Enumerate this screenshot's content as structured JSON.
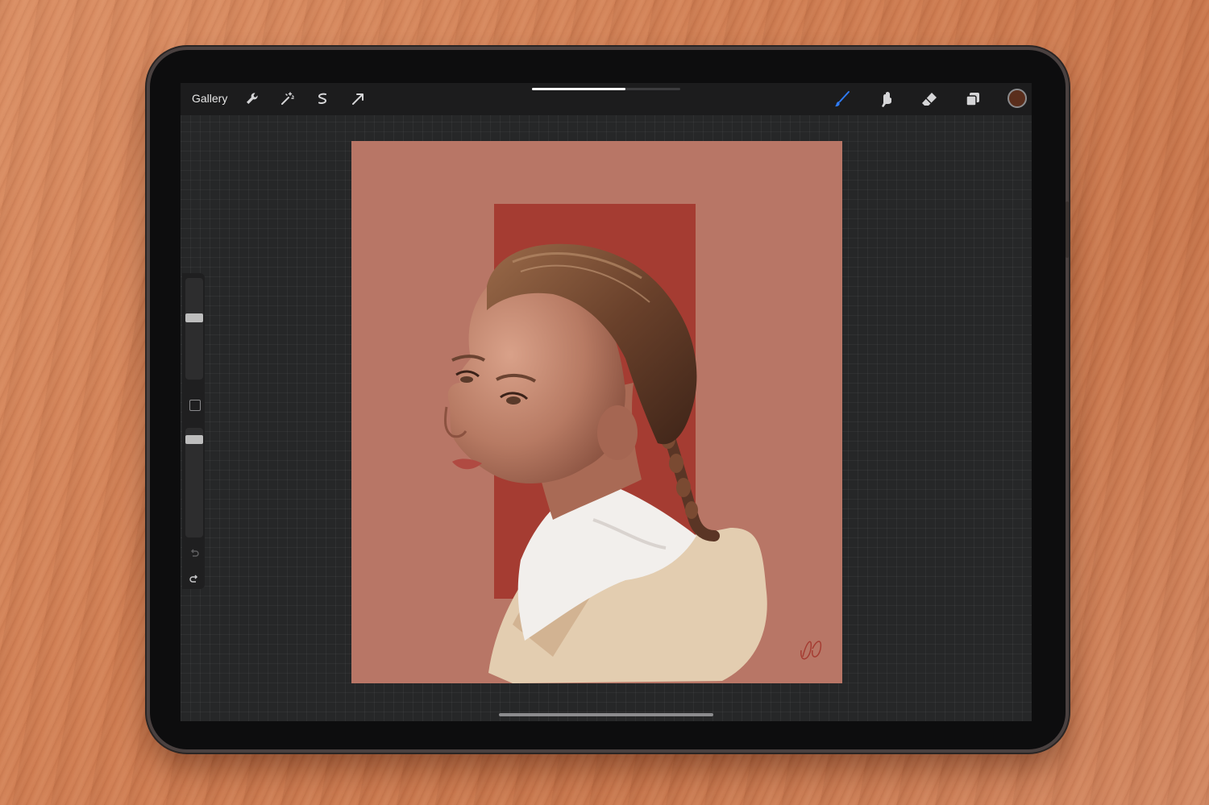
{
  "toolbar": {
    "gallery_label": "Gallery",
    "left_icons": [
      "wrench-icon",
      "magic-wand-icon",
      "selection-icon",
      "transform-arrow-icon"
    ],
    "right_icons": [
      "brush-icon",
      "smudge-icon",
      "eraser-icon",
      "layers-icon"
    ],
    "progress": 0.63
  },
  "colors": {
    "active_brush": "#2f7bf5",
    "current_color": "#5a2e1c",
    "canvas_background": "#b87666",
    "accent_panel": "#a53c32"
  },
  "sidebar": {
    "brush_size_level": 0.38,
    "opacity_level": 0.07
  }
}
